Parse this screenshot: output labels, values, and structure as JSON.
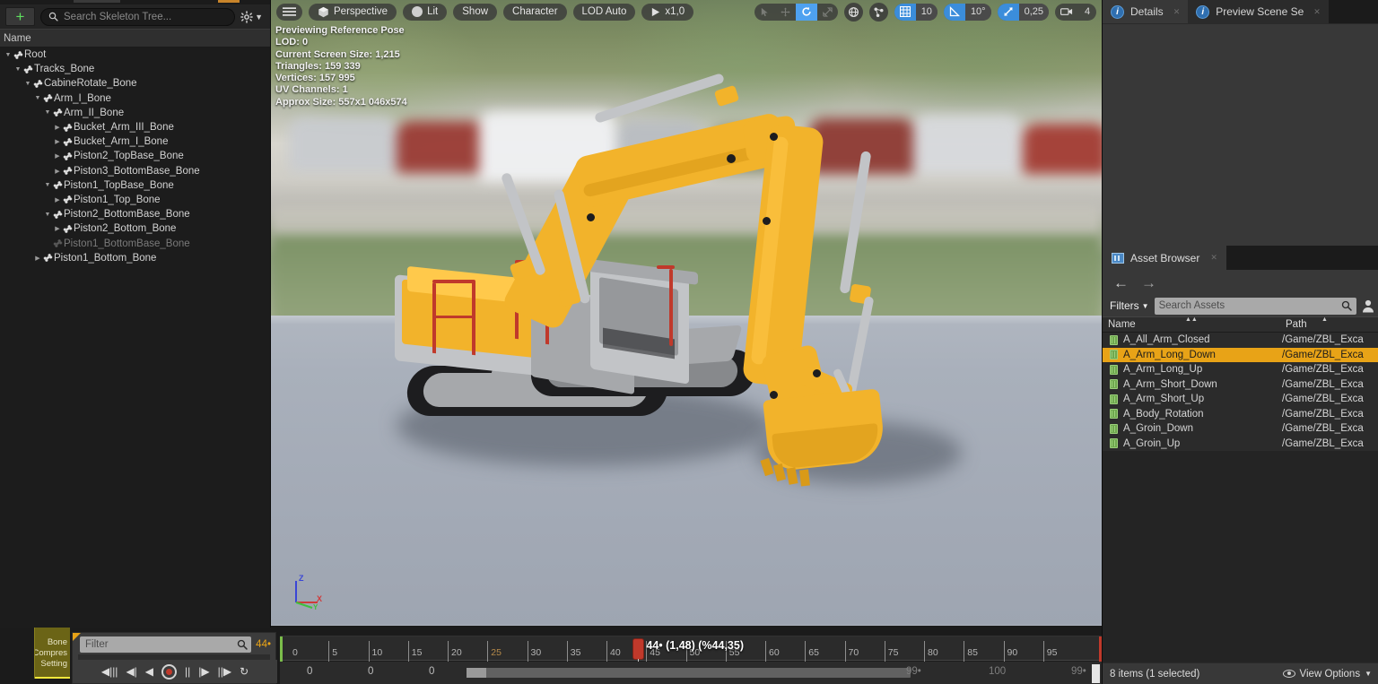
{
  "skeleton_tree": {
    "search_placeholder": "Search Skeleton Tree...",
    "add_label": "+",
    "column_header": "Name",
    "items": [
      {
        "label": "Root",
        "depth": 0,
        "arrow": "down",
        "dim": false
      },
      {
        "label": "Tracks_Bone",
        "depth": 1,
        "arrow": "down",
        "dim": false
      },
      {
        "label": "CabineRotate_Bone",
        "depth": 2,
        "arrow": "down",
        "dim": false
      },
      {
        "label": "Arm_I_Bone",
        "depth": 3,
        "arrow": "down",
        "dim": false
      },
      {
        "label": "Arm_II_Bone",
        "depth": 4,
        "arrow": "down",
        "dim": false
      },
      {
        "label": "Bucket_Arm_III_Bone",
        "depth": 5,
        "arrow": "right",
        "dim": false
      },
      {
        "label": "Bucket_Arm_I_Bone",
        "depth": 5,
        "arrow": "right",
        "dim": false
      },
      {
        "label": "Piston2_TopBase_Bone",
        "depth": 5,
        "arrow": "right",
        "dim": false
      },
      {
        "label": "Piston3_BottomBase_Bone",
        "depth": 5,
        "arrow": "right",
        "dim": false
      },
      {
        "label": "Piston1_TopBase_Bone",
        "depth": 4,
        "arrow": "down",
        "dim": false
      },
      {
        "label": "Piston1_Top_Bone",
        "depth": 5,
        "arrow": "right",
        "dim": false
      },
      {
        "label": "Piston2_BottomBase_Bone",
        "depth": 4,
        "arrow": "down",
        "dim": false
      },
      {
        "label": "Piston2_Bottom_Bone",
        "depth": 5,
        "arrow": "right",
        "dim": false
      },
      {
        "label": "Piston1_BottomBase_Bone",
        "depth": 4,
        "arrow": "",
        "dim": true
      },
      {
        "label": "Piston1_Bottom_Bone",
        "depth": 3,
        "arrow": "right",
        "dim": false
      }
    ]
  },
  "viewport": {
    "toolbar": {
      "menu_icon": "hamburger-icon",
      "view_mode": "Perspective",
      "lighting_mode": "Lit",
      "show": "Show",
      "character": "Character",
      "lod": "LOD Auto",
      "playback_speed": "x1,0"
    },
    "toolbar_right": {
      "select_icon": "cursor-select-icon",
      "translate_icon": "move-icon",
      "rotate_icon": "rotate-icon",
      "scale_icon": "scale-icon",
      "coordinate_icon": "world-space-icon",
      "surface_snap_icon": "surface-snap-icon",
      "grid_snap_value": "10",
      "rotation_snap_value": "10°",
      "scale_snap_value": "0,25",
      "camera_speed_value": "4"
    },
    "stats": [
      "Previewing Reference Pose",
      "LOD: 0",
      "Current Screen Size: 1,215",
      "Triangles: 159 339",
      "Vertices: 157 995",
      "UV Channels: 1",
      "Approx Size: 557x1 046x574"
    ],
    "gizmo": {
      "x": "X",
      "y": "Y",
      "z": "Z"
    }
  },
  "right_panel": {
    "tabs": [
      {
        "label": "Details",
        "active": true,
        "icon": "info-icon"
      },
      {
        "label": "Preview Scene Se",
        "active": false,
        "icon": "info-icon"
      }
    ],
    "asset_browser": {
      "tab_label": "Asset Browser",
      "tab_icon": "asset-browser-icon",
      "back_icon": "arrow-left-icon",
      "forward_icon": "arrow-right-icon",
      "filters_label": "Filters",
      "search_placeholder": "Search Assets",
      "search_icon": "magnifier-icon",
      "user_icon": "person-icon",
      "columns": [
        "Name",
        "Path"
      ],
      "rows": [
        {
          "name": "A_All_Arm_Closed",
          "path": "/Game/ZBL_Exca",
          "selected": false
        },
        {
          "name": "A_Arm_Long_Down",
          "path": "/Game/ZBL_Exca",
          "selected": true
        },
        {
          "name": "A_Arm_Long_Up",
          "path": "/Game/ZBL_Exca",
          "selected": false
        },
        {
          "name": "A_Arm_Short_Down",
          "path": "/Game/ZBL_Exca",
          "selected": false
        },
        {
          "name": "A_Arm_Short_Up",
          "path": "/Game/ZBL_Exca",
          "selected": false
        },
        {
          "name": "A_Body_Rotation",
          "path": "/Game/ZBL_Exca",
          "selected": false
        },
        {
          "name": "A_Groin_Down",
          "path": "/Game/ZBL_Exca",
          "selected": false
        },
        {
          "name": "A_Groin_Up",
          "path": "/Game/ZBL_Exca",
          "selected": false
        }
      ],
      "status_text": "8 items (1 selected)",
      "view_options_label": "View Options",
      "view_options_icon": "eye-icon"
    }
  },
  "bottom": {
    "bone_tab_lines": [
      "Bone",
      "Compres",
      "Setting"
    ],
    "filter_placeholder": "Filter",
    "filter_search_icon": "magnifier-icon",
    "filter_badge": "44•",
    "transport": [
      {
        "name": "step-to-start-icon",
        "glyph": "◀|||"
      },
      {
        "name": "step-back-icon",
        "glyph": "◀|"
      },
      {
        "name": "play-reverse-icon",
        "glyph": "◀"
      },
      {
        "name": "record-icon",
        "glyph": "●"
      },
      {
        "name": "pause-icon",
        "glyph": "||"
      },
      {
        "name": "step-forward-icon",
        "glyph": "|▶"
      },
      {
        "name": "step-to-end-icon",
        "glyph": "||▶"
      },
      {
        "name": "loop-icon",
        "glyph": "↻"
      }
    ],
    "timeline": {
      "ticks": [
        "0",
        "5",
        "10",
        "15",
        "20",
        "25",
        "30",
        "35",
        "40",
        "45",
        "50",
        "55",
        "60",
        "65",
        "70",
        "75",
        "80",
        "85",
        "90",
        "95"
      ],
      "playhead_label": "44• (1,48) (%44,35)",
      "playhead_frame": 44,
      "track_values": [
        "0",
        "0",
        "0",
        "99•",
        "100",
        "99•"
      ]
    }
  }
}
